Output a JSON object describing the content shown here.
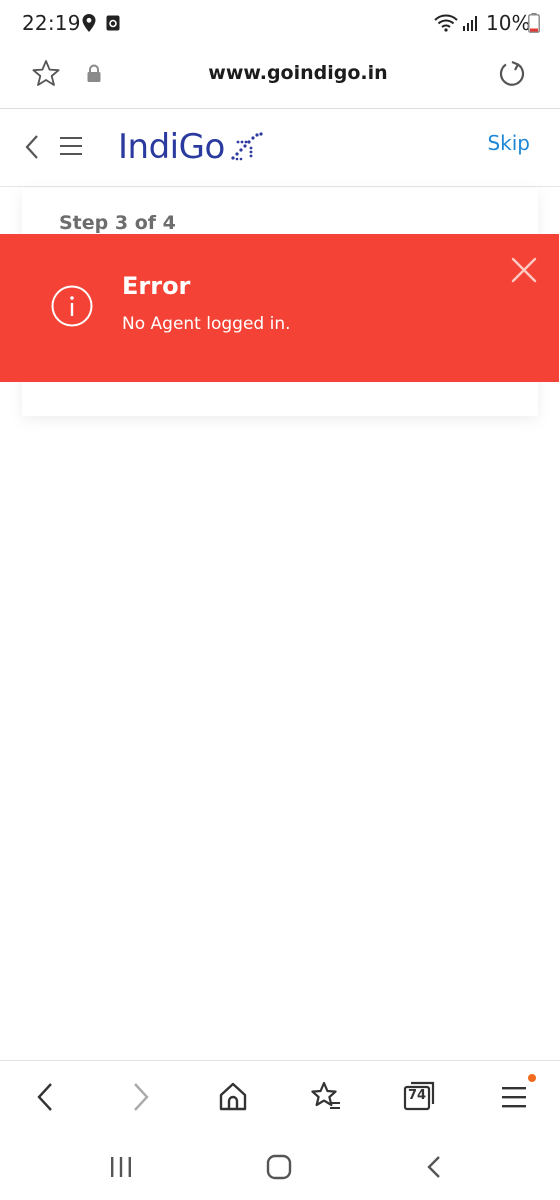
{
  "status_bar": {
    "time": "22:19",
    "battery": "10%",
    "icons": [
      "location-icon",
      "app-notification-icon",
      "wifi-icon",
      "signal-icon",
      "battery-icon"
    ]
  },
  "browser": {
    "url": "www.goindigo.in",
    "icons": [
      "star-icon",
      "lock-icon",
      "reload-icon"
    ]
  },
  "header": {
    "logo_text": "IndiGo",
    "skip_label": "Skip",
    "brand_color": "#2a3a9e",
    "link_color": "#1e88d6"
  },
  "main": {
    "step_text": "Step 3 of 4"
  },
  "error_toast": {
    "title": "Error",
    "message": "No Agent logged in.",
    "background_color": "#f44336"
  },
  "bottom_toolbar": {
    "tab_count": "74",
    "icons": [
      "back-icon",
      "forward-icon",
      "home-icon",
      "bookmarks-icon",
      "tabs-icon",
      "menu-icon"
    ]
  },
  "nav_bar": {
    "icons": [
      "recent-apps-icon",
      "home-icon",
      "back-icon"
    ]
  }
}
